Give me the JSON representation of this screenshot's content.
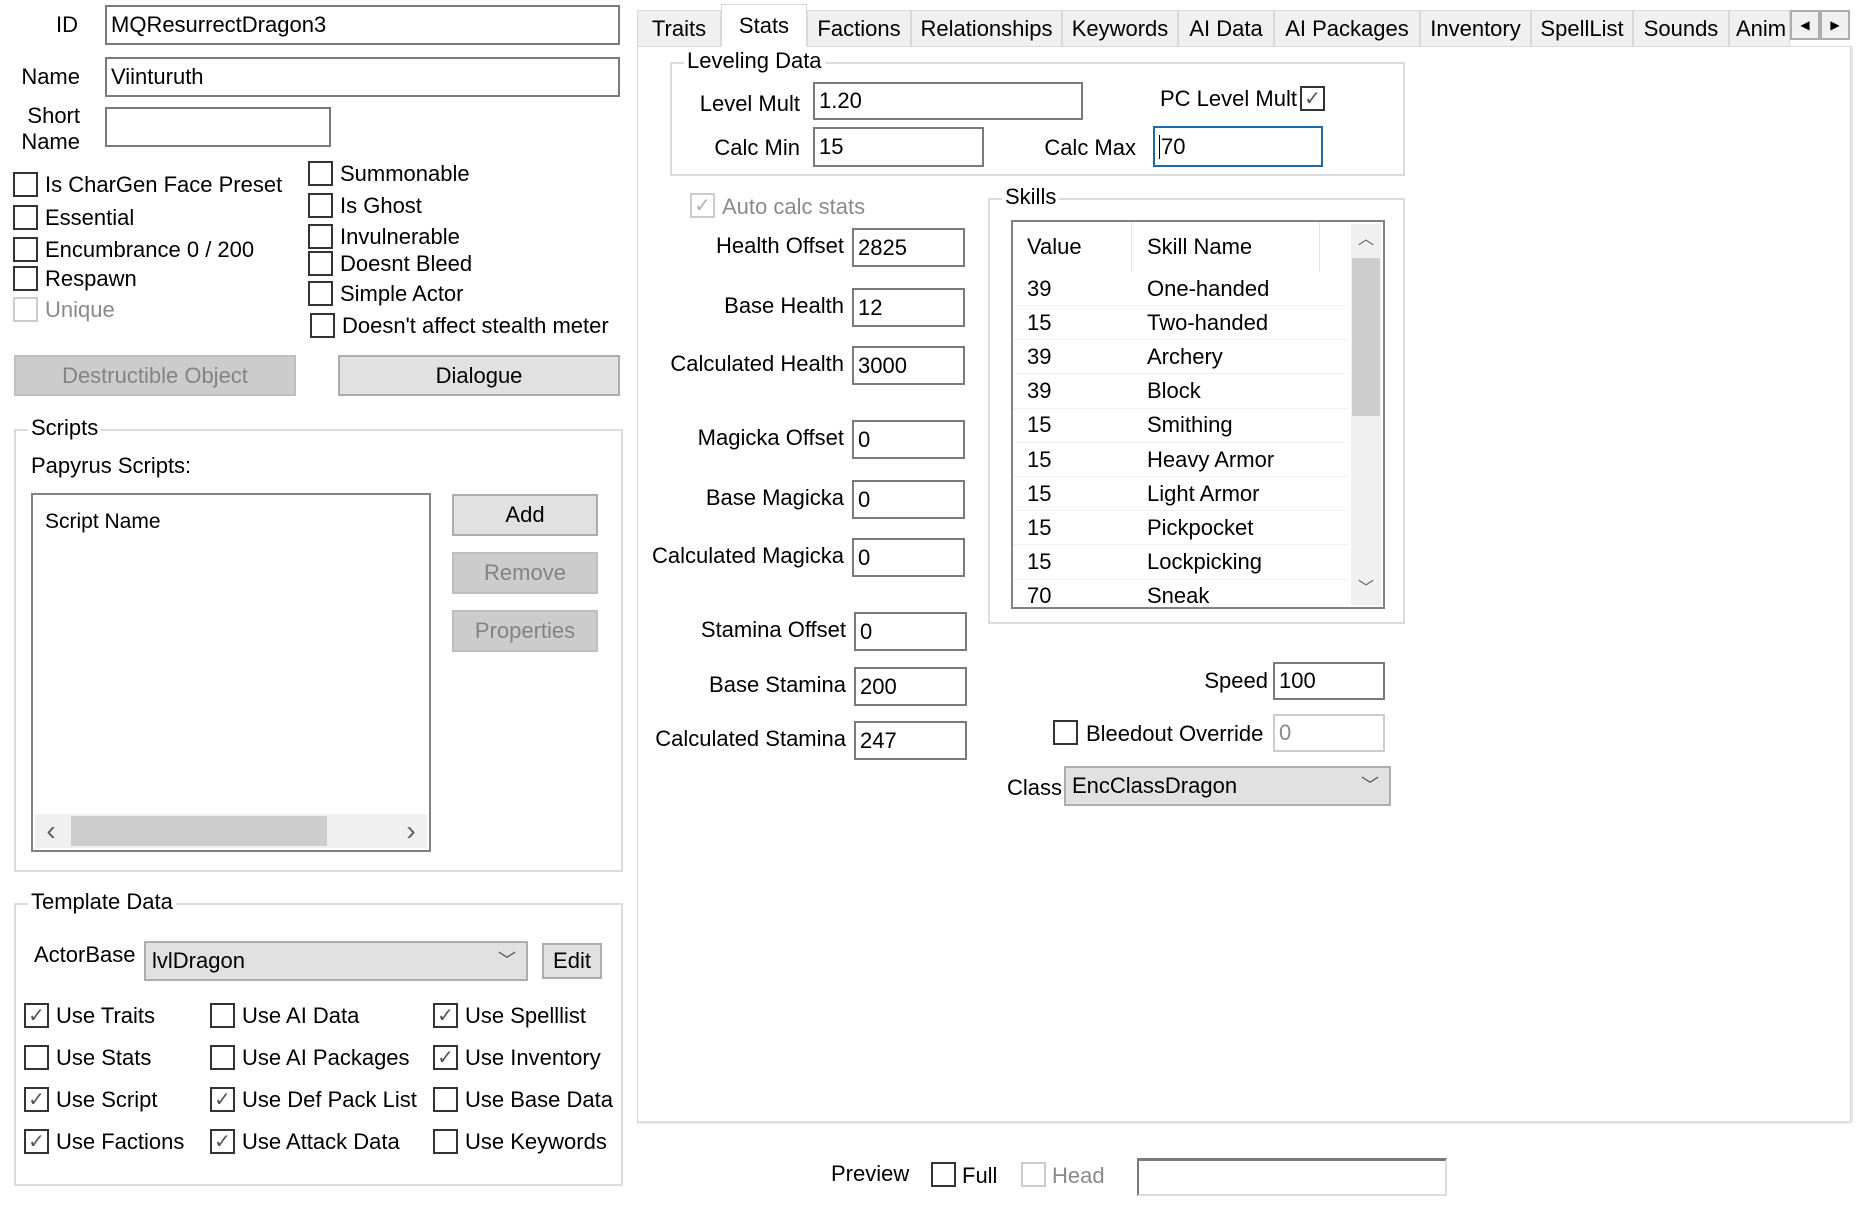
{
  "identity": {
    "id_label": "ID",
    "id_value": "MQResurrectDragon3",
    "name_label": "Name",
    "name_value": "Viinturuth",
    "short_name_label_1": "Short",
    "short_name_label_2": "Name",
    "short_name_value": ""
  },
  "flags_left": [
    {
      "label": "Is CharGen Face Preset",
      "checked": false,
      "disabled": false
    },
    {
      "label": "Essential",
      "checked": false,
      "disabled": false
    },
    {
      "label": "Encumbrance 0 / 200",
      "checked": false,
      "disabled": false
    },
    {
      "label": "Respawn",
      "checked": false,
      "disabled": false
    },
    {
      "label": "Unique",
      "checked": false,
      "disabled": true
    }
  ],
  "flags_right": [
    {
      "label": "Summonable",
      "checked": false
    },
    {
      "label": "Is Ghost",
      "checked": false
    },
    {
      "label": "Invulnerable",
      "checked": false
    },
    {
      "label": "Doesnt Bleed",
      "checked": false
    },
    {
      "label": "Simple Actor",
      "checked": false
    },
    {
      "label": "Doesn't affect stealth meter",
      "checked": false
    }
  ],
  "buttons": {
    "destructible": "Destructible Object",
    "dialogue": "Dialogue"
  },
  "scripts": {
    "group_title": "Scripts",
    "papyrus_label": "Papyrus Scripts:",
    "column_header": "Script Name",
    "add": "Add",
    "remove": "Remove",
    "properties": "Properties",
    "hscroll_left": "‹",
    "hscroll_right": "›"
  },
  "template": {
    "group_title": "Template Data",
    "actorbase_label": "ActorBase",
    "actorbase_value": "lvlDragon",
    "edit": "Edit",
    "flags": [
      {
        "label": "Use Traits",
        "checked": true
      },
      {
        "label": "Use AI Data",
        "checked": false
      },
      {
        "label": "Use Spelllist",
        "checked": true
      },
      {
        "label": "Use Stats",
        "checked": false
      },
      {
        "label": "Use AI Packages",
        "checked": false
      },
      {
        "label": "Use Inventory",
        "checked": true
      },
      {
        "label": "Use Script",
        "checked": true
      },
      {
        "label": "Use Def Pack List",
        "checked": true
      },
      {
        "label": "Use Base Data",
        "checked": false
      },
      {
        "label": "Use Factions",
        "checked": true
      },
      {
        "label": "Use Attack Data",
        "checked": true
      },
      {
        "label": "Use Keywords",
        "checked": false
      }
    ]
  },
  "tabs": [
    {
      "label": "Traits",
      "active": false
    },
    {
      "label": "Stats",
      "active": true
    },
    {
      "label": "Factions",
      "active": false
    },
    {
      "label": "Relationships",
      "active": false
    },
    {
      "label": "Keywords",
      "active": false
    },
    {
      "label": "AI Data",
      "active": false
    },
    {
      "label": "AI Packages",
      "active": false
    },
    {
      "label": "Inventory",
      "active": false
    },
    {
      "label": "SpellList",
      "active": false
    },
    {
      "label": "Sounds",
      "active": false
    },
    {
      "label": "Anim",
      "active": false
    }
  ],
  "tab_scroll": {
    "left": "◀",
    "right": "▶"
  },
  "leveling": {
    "group_title": "Leveling Data",
    "level_mult_label": "Level Mult",
    "level_mult_value": "1.20",
    "pc_level_mult_label": "PC Level Mult",
    "pc_level_mult_checked": true,
    "calc_min_label": "Calc Min",
    "calc_min_value": "15",
    "calc_max_label": "Calc Max",
    "calc_max_value": "70"
  },
  "stats": {
    "auto_calc_label": "Auto calc stats",
    "auto_calc_checked": true,
    "health_offset_label": "Health Offset",
    "health_offset_value": "2825",
    "base_health_label": "Base Health",
    "base_health_value": "12",
    "calc_health_label": "Calculated Health",
    "calc_health_value": "3000",
    "magicka_offset_label": "Magicka Offset",
    "magicka_offset_value": "0",
    "base_magicka_label": "Base Magicka",
    "base_magicka_value": "0",
    "calc_magicka_label": "Calculated Magicka",
    "calc_magicka_value": "0",
    "stamina_offset_label": "Stamina Offset",
    "stamina_offset_value": "0",
    "base_stamina_label": "Base Stamina",
    "base_stamina_value": "200",
    "calc_stamina_label": "Calculated Stamina",
    "calc_stamina_value": "247"
  },
  "skills": {
    "group_title": "Skills",
    "headers": {
      "value": "Value",
      "name": "Skill Name"
    },
    "rows": [
      {
        "value": "39",
        "name": "One-handed"
      },
      {
        "value": "15",
        "name": "Two-handed"
      },
      {
        "value": "39",
        "name": "Archery"
      },
      {
        "value": "39",
        "name": "Block"
      },
      {
        "value": "15",
        "name": "Smithing"
      },
      {
        "value": "15",
        "name": "Heavy Armor"
      },
      {
        "value": "15",
        "name": "Light Armor"
      },
      {
        "value": "15",
        "name": "Pickpocket"
      },
      {
        "value": "15",
        "name": "Lockpicking"
      },
      {
        "value": "70",
        "name": "Sneak"
      }
    ]
  },
  "misc": {
    "speed_label": "Speed",
    "speed_value": "100",
    "bleedout_label": "Bleedout Override",
    "bleedout_checked": false,
    "bleedout_value": "0",
    "class_label": "Class",
    "class_value": "EncClassDragon"
  },
  "preview": {
    "label": "Preview",
    "full_label": "Full",
    "full_checked": false,
    "head_label": "Head",
    "head_checked": false,
    "head_disabled": true,
    "input_value": ""
  }
}
